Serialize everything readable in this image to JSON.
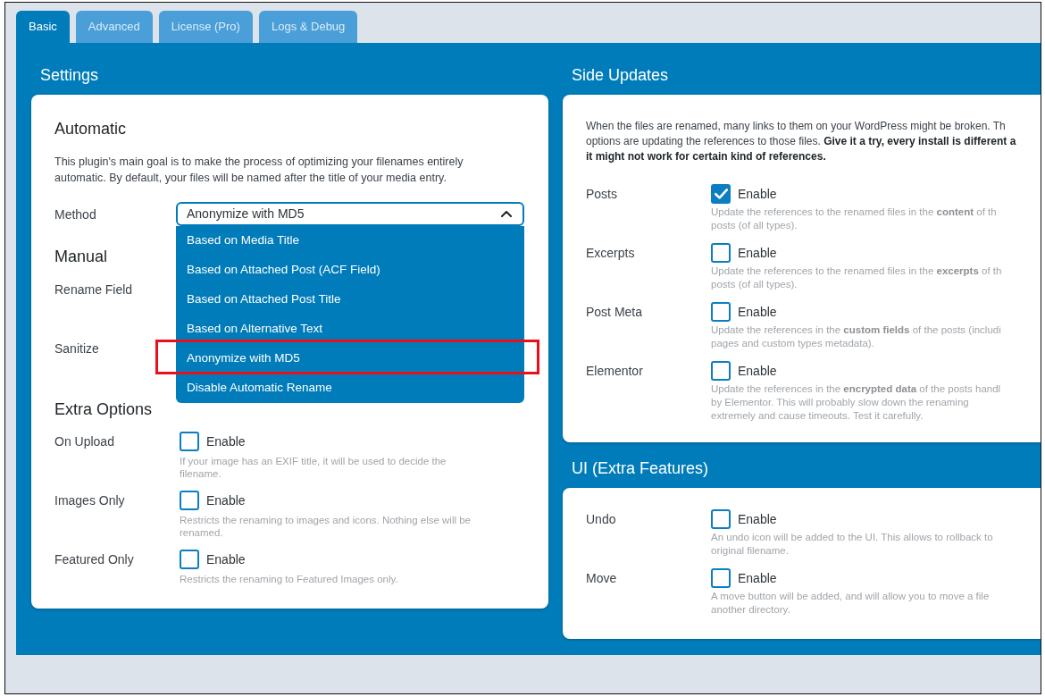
{
  "tabs": [
    {
      "label": "Basic",
      "selected": true
    },
    {
      "label": "Advanced",
      "selected": false
    },
    {
      "label": "License (Pro)",
      "selected": false
    },
    {
      "label": "Logs & Debug",
      "selected": false
    }
  ],
  "settings": {
    "title": "Settings",
    "automatic": {
      "heading": "Automatic",
      "description": "This plugin's main goal is to make the process of optimizing your filenames entirely automatic. By default, your files will be named after the title of your media entry.",
      "method": {
        "label": "Method",
        "value": "Anonymize with MD5",
        "expanded": true,
        "options": [
          {
            "label": "Based on Media Title",
            "highlighted": false
          },
          {
            "label": "Based on Attached Post (ACF Field)",
            "highlighted": false
          },
          {
            "label": "Based on Attached Post Title",
            "highlighted": false
          },
          {
            "label": "Based on Alternative Text",
            "highlighted": false
          },
          {
            "label": "Anonymize with MD5",
            "highlighted": true
          },
          {
            "label": "Disable Automatic Rename",
            "highlighted": false
          }
        ]
      }
    },
    "manual": {
      "heading": "Manual",
      "fields": [
        {
          "label": "Rename Field"
        },
        {
          "label": "Sanitize"
        }
      ]
    },
    "extra_options": {
      "heading": "Extra Options",
      "options": [
        {
          "label": "On Upload",
          "checkbox_label": "Enable",
          "checked": false,
          "description": "If your image has an EXIF title, it will be used to decide the filename."
        },
        {
          "label": "Images Only",
          "checkbox_label": "Enable",
          "checked": false,
          "description": "Restricts the renaming to images and icons. Nothing else will be renamed."
        },
        {
          "label": "Featured Only",
          "checkbox_label": "Enable",
          "checked": false,
          "description": "Restricts the renaming to Featured Images only."
        }
      ]
    }
  },
  "side_updates": {
    "title": "Side Updates",
    "intro": "When the files are renamed, many links to them on your WordPress might be broken. Th\noptions are updating the references to those files. **Give it a try, every install is different a**\n**it might not work for certain kind of references.**",
    "options": [
      {
        "label": "Posts",
        "checkbox_label": "Enable",
        "checked": true,
        "description": "Update the references to the renamed files in the **content** of th\nposts (of all types)."
      },
      {
        "label": "Excerpts",
        "checkbox_label": "Enable",
        "checked": false,
        "description": "Update the references to the renamed files in the **excerpts** of th\nposts (of all types)."
      },
      {
        "label": "Post Meta",
        "checkbox_label": "Enable",
        "checked": false,
        "description": "Update the references in the **custom fields** of the posts (includi\npages and custom types metadata)."
      },
      {
        "label": "Elementor",
        "checkbox_label": "Enable",
        "checked": false,
        "description": "Update the references in the **encrypted data** of the posts handl\nby Elementor. This will probably slow down the renaming\nextremely and cause timeouts. Test it carefully."
      }
    ]
  },
  "ui_extra_features": {
    "title": "UI (Extra Features)",
    "options": [
      {
        "label": "Undo",
        "checkbox_label": "Enable",
        "checked": false,
        "description": "An undo icon will be added to the UI. This allows to rollback to\noriginal filename."
      },
      {
        "label": "Move",
        "checkbox_label": "Enable",
        "checked": false,
        "description": "A move button will be added, and will allow you to move a file\nanother directory."
      }
    ]
  }
}
